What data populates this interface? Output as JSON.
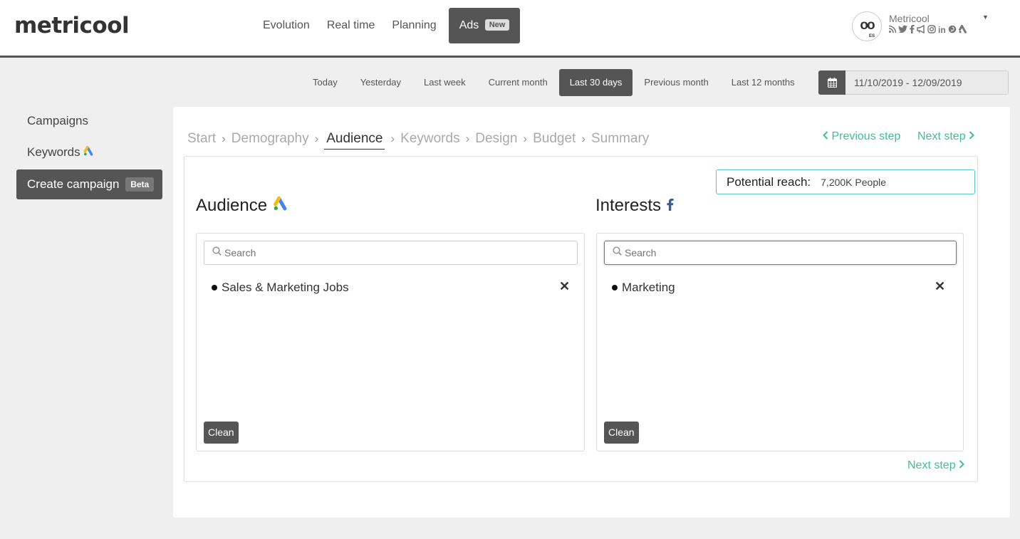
{
  "header": {
    "logo": "metricool",
    "nav": [
      "Evolution",
      "Real time",
      "Planning"
    ],
    "nav_active": "Ads",
    "nav_active_badge": "New",
    "account_name": "Metricool",
    "account_lang": "ES",
    "social_icons": [
      "rss-icon",
      "twitter-icon",
      "facebook-icon",
      "megaphone-icon",
      "instagram-icon",
      "linkedin-icon",
      "pinterest-icon",
      "google-ads-icon"
    ]
  },
  "dates": {
    "ranges": [
      "Today",
      "Yesterday",
      "Last week",
      "Current month",
      "Last 30 days",
      "Previous month",
      "Last 12 months"
    ],
    "active_range": "Last 30 days",
    "range_value": "11/10/2019 - 12/09/2019"
  },
  "sidebar": {
    "campaigns": "Campaigns",
    "keywords": "Keywords",
    "create": "Create campaign",
    "create_badge": "Beta"
  },
  "wizard": {
    "steps": [
      "Start",
      "Demography",
      "Audience",
      "Keywords",
      "Design",
      "Budget",
      "Summary"
    ],
    "active_step": "Audience",
    "prev": "Previous step",
    "next": "Next step"
  },
  "reach": {
    "label": "Potential reach:",
    "value": "7,200K People"
  },
  "audience": {
    "title": "Audience",
    "search_placeholder": "Search",
    "items": [
      "Sales & Marketing Jobs"
    ],
    "clean": "Clean"
  },
  "interests": {
    "title": "Interests",
    "search_placeholder": "Search",
    "items": [
      "Marketing"
    ],
    "clean": "Clean"
  },
  "colors": {
    "accent": "#3fbf99",
    "dark": "#555555",
    "reach_border": "#5cc4c8",
    "facebook": "#3b5998"
  }
}
